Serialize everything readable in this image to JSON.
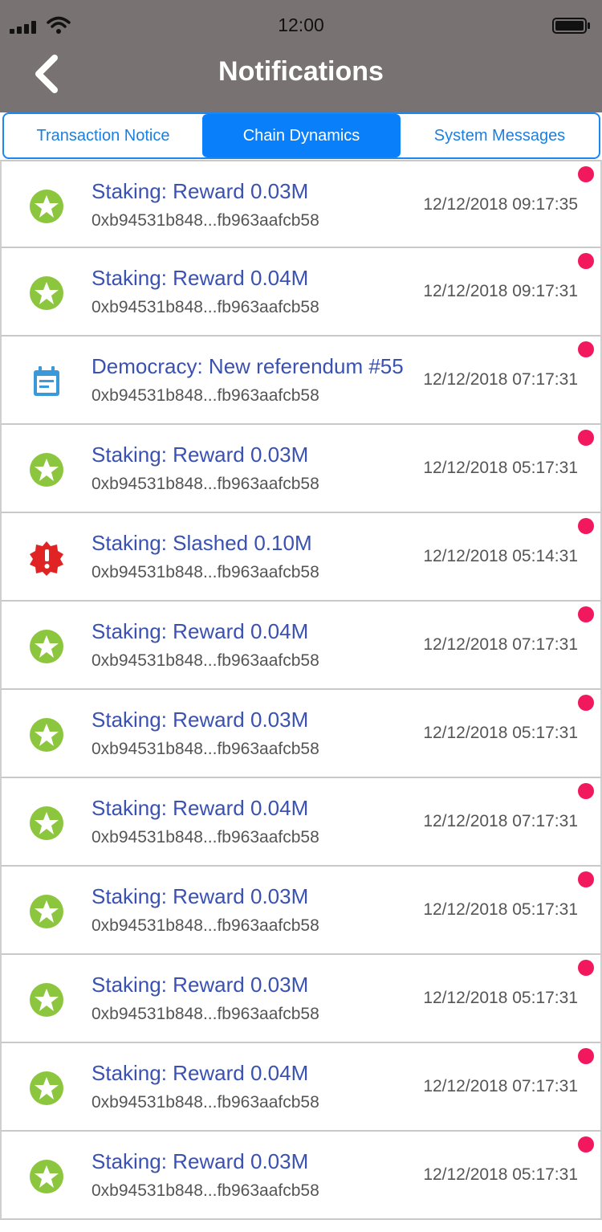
{
  "status_bar": {
    "time": "12:00",
    "icons": [
      "signal-icon",
      "wifi-icon",
      "battery-icon"
    ]
  },
  "header": {
    "title": "Notifications",
    "back_icon": "chevron-left-icon"
  },
  "tabs": [
    {
      "label": "Transaction Notice",
      "active": false
    },
    {
      "label": "Chain Dynamics",
      "active": true
    },
    {
      "label": "System Messages",
      "active": false
    }
  ],
  "colors": {
    "header_bg": "#797272",
    "accent": "#0a7ffa",
    "title_text": "#3a51b2",
    "reward_icon": "#8cc63f",
    "slash_icon": "#e02323",
    "referendum_icon": "#3a9ad9",
    "unread_dot": "#f2185d"
  },
  "notifications": [
    {
      "icon": "star-badge-icon",
      "title": "Staking: Reward 0.03M",
      "address": "0xb94531b848...fb963aafcb58",
      "time": "12/12/2018 09:17:35",
      "unread": true
    },
    {
      "icon": "star-badge-icon",
      "title": "Staking: Reward 0.04M",
      "address": "0xb94531b848...fb963aafcb58",
      "time": "12/12/2018 09:17:31",
      "unread": true
    },
    {
      "icon": "calendar-icon",
      "title": "Democracy: New referendum #55",
      "address": "0xb94531b848...fb963aafcb58",
      "time": "12/12/2018 07:17:31",
      "unread": true
    },
    {
      "icon": "star-badge-icon",
      "title": "Staking: Reward 0.03M",
      "address": "0xb94531b848...fb963aafcb58",
      "time": "12/12/2018 05:17:31",
      "unread": true
    },
    {
      "icon": "alert-badge-icon",
      "title": "Staking: Slashed 0.10M",
      "address": "0xb94531b848...fb963aafcb58",
      "time": "12/12/2018 05:14:31",
      "unread": true
    },
    {
      "icon": "star-badge-icon",
      "title": "Staking: Reward 0.04M",
      "address": "0xb94531b848...fb963aafcb58",
      "time": "12/12/2018 07:17:31",
      "unread": true
    },
    {
      "icon": "star-badge-icon",
      "title": "Staking: Reward 0.03M",
      "address": "0xb94531b848...fb963aafcb58",
      "time": "12/12/2018 05:17:31",
      "unread": true
    },
    {
      "icon": "star-badge-icon",
      "title": "Staking: Reward 0.04M",
      "address": "0xb94531b848...fb963aafcb58",
      "time": "12/12/2018 07:17:31",
      "unread": true
    },
    {
      "icon": "star-badge-icon",
      "title": "Staking: Reward 0.03M",
      "address": "0xb94531b848...fb963aafcb58",
      "time": "12/12/2018 05:17:31",
      "unread": true
    },
    {
      "icon": "star-badge-icon",
      "title": "Staking: Reward 0.03M",
      "address": "0xb94531b848...fb963aafcb58",
      "time": "12/12/2018 05:17:31",
      "unread": true
    },
    {
      "icon": "star-badge-icon",
      "title": "Staking: Reward 0.04M",
      "address": "0xb94531b848...fb963aafcb58",
      "time": "12/12/2018 07:17:31",
      "unread": true
    },
    {
      "icon": "star-badge-icon",
      "title": "Staking: Reward 0.03M",
      "address": "0xb94531b848...fb963aafcb58",
      "time": "12/12/2018 05:17:31",
      "unread": true
    }
  ]
}
